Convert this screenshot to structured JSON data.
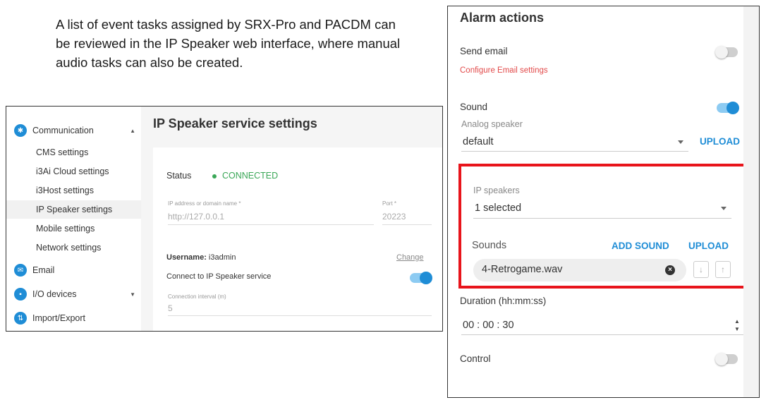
{
  "intro": {
    "lines": [
      "A list of event tasks assigned by SRX-Pro and PACDM can",
      "be reviewed in the IP Speaker web interface, where manual",
      "audio tasks can also be created."
    ]
  },
  "service_settings": {
    "sidebar": {
      "communication": {
        "label": "Communication",
        "icon": "communication-icon"
      },
      "items": [
        {
          "label": "CMS settings"
        },
        {
          "label": "i3Ai Cloud settings"
        },
        {
          "label": "i3Host settings"
        },
        {
          "label": "IP Speaker settings",
          "active": true
        },
        {
          "label": "Mobile settings"
        },
        {
          "label": "Network settings"
        }
      ],
      "email": {
        "label": "Email",
        "icon": "email-icon"
      },
      "io_devices": {
        "label": "I/O devices",
        "icon": "io-devices-icon"
      },
      "import_export": {
        "label": "Import/Export",
        "icon": "import-export-icon"
      }
    },
    "title": "IP Speaker service settings",
    "status_label": "Status",
    "status_value": "CONNECTED",
    "ip_label": "IP address or domain name *",
    "ip_value": "http://127.0.0.1",
    "port_label": "Port *",
    "port_value": "20223",
    "username_key": "Username:",
    "username_value": "i3admin",
    "change_label": "Change",
    "connect_label": "Connect to IP Speaker service",
    "connect_on": true,
    "interval_label": "Connection interval (m)",
    "interval_value": "5",
    "colors": {
      "accent": "#1f8dd6",
      "connected": "#3aa757"
    }
  },
  "alarm_actions": {
    "title": "Alarm actions",
    "send_email_label": "Send email",
    "send_email_on": false,
    "configure_email_link": "Configure Email settings",
    "sound_label": "Sound",
    "sound_on": true,
    "analog_speaker_label": "Analog speaker",
    "analog_speaker_value": "default",
    "upload_label": "UPLOAD",
    "ip_speakers_label": "IP speakers",
    "ip_speakers_value": "1 selected",
    "sounds_label": "Sounds",
    "add_sound_label": "ADD SOUND",
    "upload_label_2": "UPLOAD",
    "sound_file": "4-Retrogame.wav",
    "duration_label": "Duration (hh:mm:ss)",
    "duration_value": "00 : 00 : 30",
    "control_label": "Control",
    "control_on": false,
    "colors": {
      "highlight": "#e8141b",
      "link": "#e24a4a",
      "accent": "#1f8dd6"
    }
  }
}
